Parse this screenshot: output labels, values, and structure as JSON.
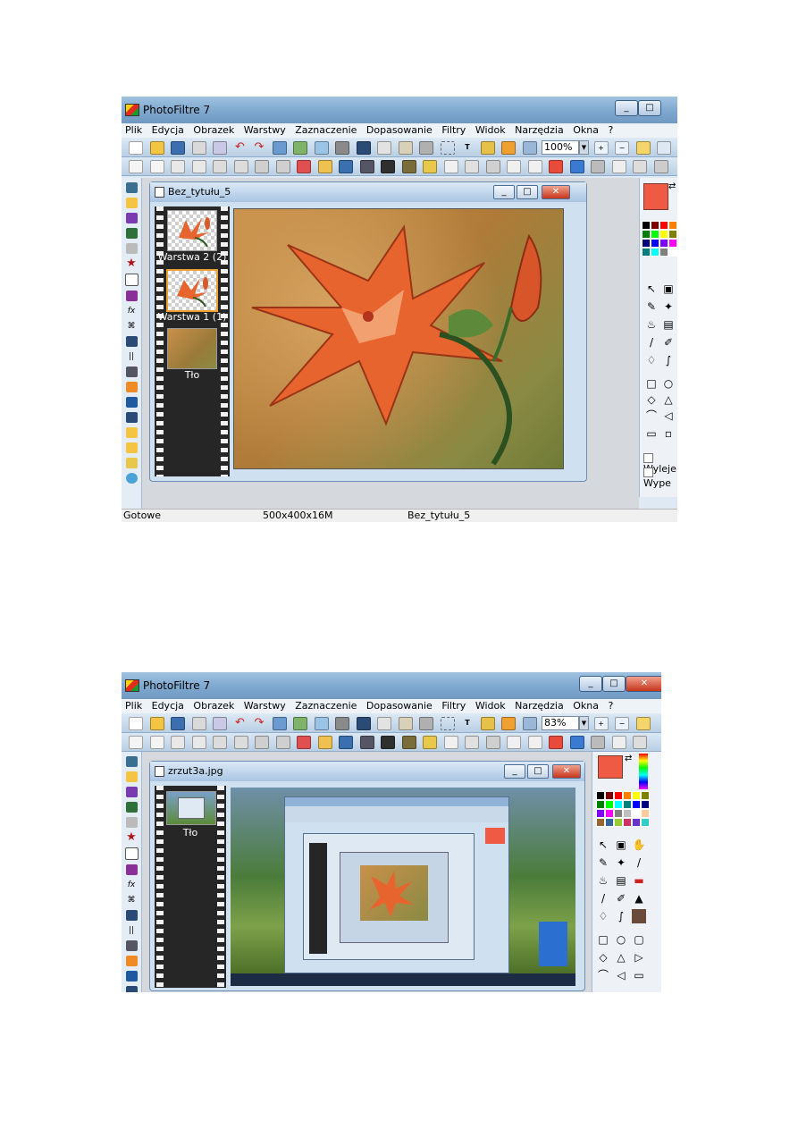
{
  "screenshot1": {
    "app_title": "PhotoFiltre 7",
    "menu": [
      "Plik",
      "Edycja",
      "Obrazek",
      "Warstwy",
      "Zaznaczenie",
      "Dopasowanie",
      "Filtry",
      "Widok",
      "Narzędzia",
      "Okna",
      "?"
    ],
    "zoom": "100%",
    "document": {
      "title": "Bez_tytułu_5",
      "layers": [
        "Warstwa 2 (2)",
        "Warstwa 1 (1)",
        "Tło"
      ]
    },
    "checkboxes": [
      "Wyleje",
      "Wype"
    ],
    "status": {
      "state": "Gotowe",
      "size": "500x400x16M",
      "file": "Bez_tytułu_5"
    },
    "accent_color": "#ef5a45"
  },
  "screenshot2": {
    "app_title": "PhotoFiltre 7",
    "menu": [
      "Plik",
      "Edycja",
      "Obrazek",
      "Warstwy",
      "Zaznaczenie",
      "Dopasowanie",
      "Filtry",
      "Widok",
      "Narzędzia",
      "Okna",
      "?"
    ],
    "zoom": "83%",
    "document": {
      "title": "zrzut3a.jpg",
      "layers": [
        "Tło"
      ]
    }
  }
}
